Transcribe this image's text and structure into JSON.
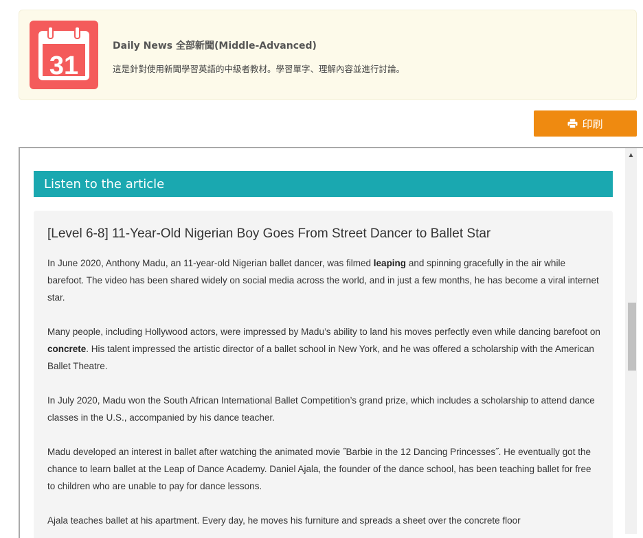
{
  "banner": {
    "icon": "calendar-icon",
    "icon_day": "31",
    "title": "Daily News 全部新聞(Middle-Advanced)",
    "description": "這是針對使用新聞學習英語的中級者教材。學習單字、理解內容並進行討論。"
  },
  "print_button": {
    "label": "印刷",
    "icon": "printer-icon"
  },
  "listen": {
    "label": "Listen to the article"
  },
  "article": {
    "title": "[Level 6-8] 11-Year-Old Nigerian Boy Goes From Street Dancer to Ballet Star",
    "p1": {
      "before": "In June 2020, Anthony Madu, an 11-year-old Nigerian ballet dancer, was filmed ",
      "keyword": "leaping",
      "after": " and spinning gracefully in the air while barefoot. The video has been shared widely on social media across the world, and in just a few months, he has become a viral internet star."
    },
    "p2": {
      "before": "Many people, including Hollywood actors, were impressed by Madu’s ability to land his moves perfectly even while dancing barefoot on ",
      "keyword": "concrete",
      "after": ". His talent impressed the artistic director of a ballet school in New York, and he was offered a scholarship with the American Ballet Theatre."
    },
    "p3": "In July 2020, Madu won the South African International Ballet Competition’s grand prize, which includes a scholarship to attend dance classes in the U.S., accompanied by his dance teacher.",
    "p4": "Madu developed an interest in ballet after watching the animated movie ˝Barbie in the 12 Dancing Princesses˝. He eventually got the chance to learn ballet at the Leap of Dance Academy. Daniel Ajala, the founder of the dance school, has been teaching ballet for free to children who are unable to pay for dance lessons.",
    "p5": "Ajala teaches ballet at his apartment. Every day, he moves his furniture and spreads a sheet over the concrete floor"
  },
  "colors": {
    "banner_bg": "#fdfaea",
    "icon_red": "#f45b5b",
    "print_orange": "#ef8a10",
    "listen_teal": "#1aa8b0",
    "article_bg": "#f4f4f4"
  }
}
